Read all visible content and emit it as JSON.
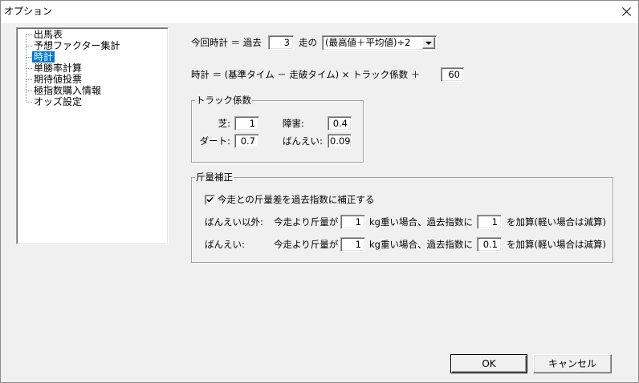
{
  "window": {
    "title": "オプション",
    "close_icon": "close-icon"
  },
  "tree": {
    "items": [
      {
        "label": "出馬表",
        "selected": false
      },
      {
        "label": "予想ファクター集計",
        "selected": false
      },
      {
        "label": "時計",
        "selected": true
      },
      {
        "label": "単勝率計算",
        "selected": false
      },
      {
        "label": "期待値投票",
        "selected": false
      },
      {
        "label": "極指数購入情報",
        "selected": false
      },
      {
        "label": "オッズ設定",
        "selected": false
      }
    ]
  },
  "clock": {
    "current_prefix": "今回時計 ＝ 過去",
    "past_races": "3",
    "past_races_suffix": "走の",
    "method": "(最高値＋平均値)÷2",
    "method_icon": "chevron-down-icon",
    "formula": "時計 ＝ (基準タイム － 走破タイム) × トラック係数 ＋",
    "formula_constant": "60"
  },
  "track_coefficient": {
    "title": "トラック係数",
    "turf": {
      "label": "芝:",
      "value": "1"
    },
    "obstacle": {
      "label": "障害:",
      "value": "0.4"
    },
    "dirt": {
      "label": "ダート:",
      "value": "0.7"
    },
    "banei": {
      "label": "ばんえい:",
      "value": "0.09"
    }
  },
  "weight_correction": {
    "title": "斤量補正",
    "checkbox_label": "今走との斤量差を過去指数に補正する",
    "checked": true,
    "check_icon": "check-icon",
    "rows": [
      {
        "label": "ばんえい以外:",
        "text_before": "今走より斤量が",
        "kg": "1",
        "text_middle": "kg重い場合、過去指数に",
        "add": "1",
        "text_after": "を加算(軽い場合は減算)"
      },
      {
        "label": "ばんえい:",
        "text_before": "今走より斤量が",
        "kg": "1",
        "text_middle": "kg重い場合、過去指数に",
        "add": "0.1",
        "text_after": "を加算(軽い場合は減算)"
      }
    ]
  },
  "buttons": {
    "ok": "OK",
    "cancel": "キャンセル"
  },
  "colors": {
    "dialog_background": "#f0f0f0",
    "title_bar_background": "#ffffff",
    "selection_background": "#0078d7",
    "selection_text": "#ffffff",
    "field_background": "#ffffff"
  }
}
